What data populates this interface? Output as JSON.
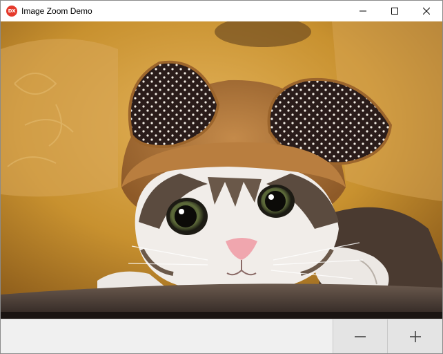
{
  "window": {
    "title": "Image Zoom Demo",
    "app_icon_text": "DX",
    "app_icon_color": "#e5392b"
  },
  "caption": {
    "minimize_icon": "minimize-icon",
    "maximize_icon": "maximize-icon",
    "close_icon": "close-icon"
  },
  "image": {
    "subject": "photo-cat-in-bear-ear-hat"
  },
  "zoom": {
    "zoom_out_icon": "minus-icon",
    "zoom_in_icon": "plus-icon"
  }
}
